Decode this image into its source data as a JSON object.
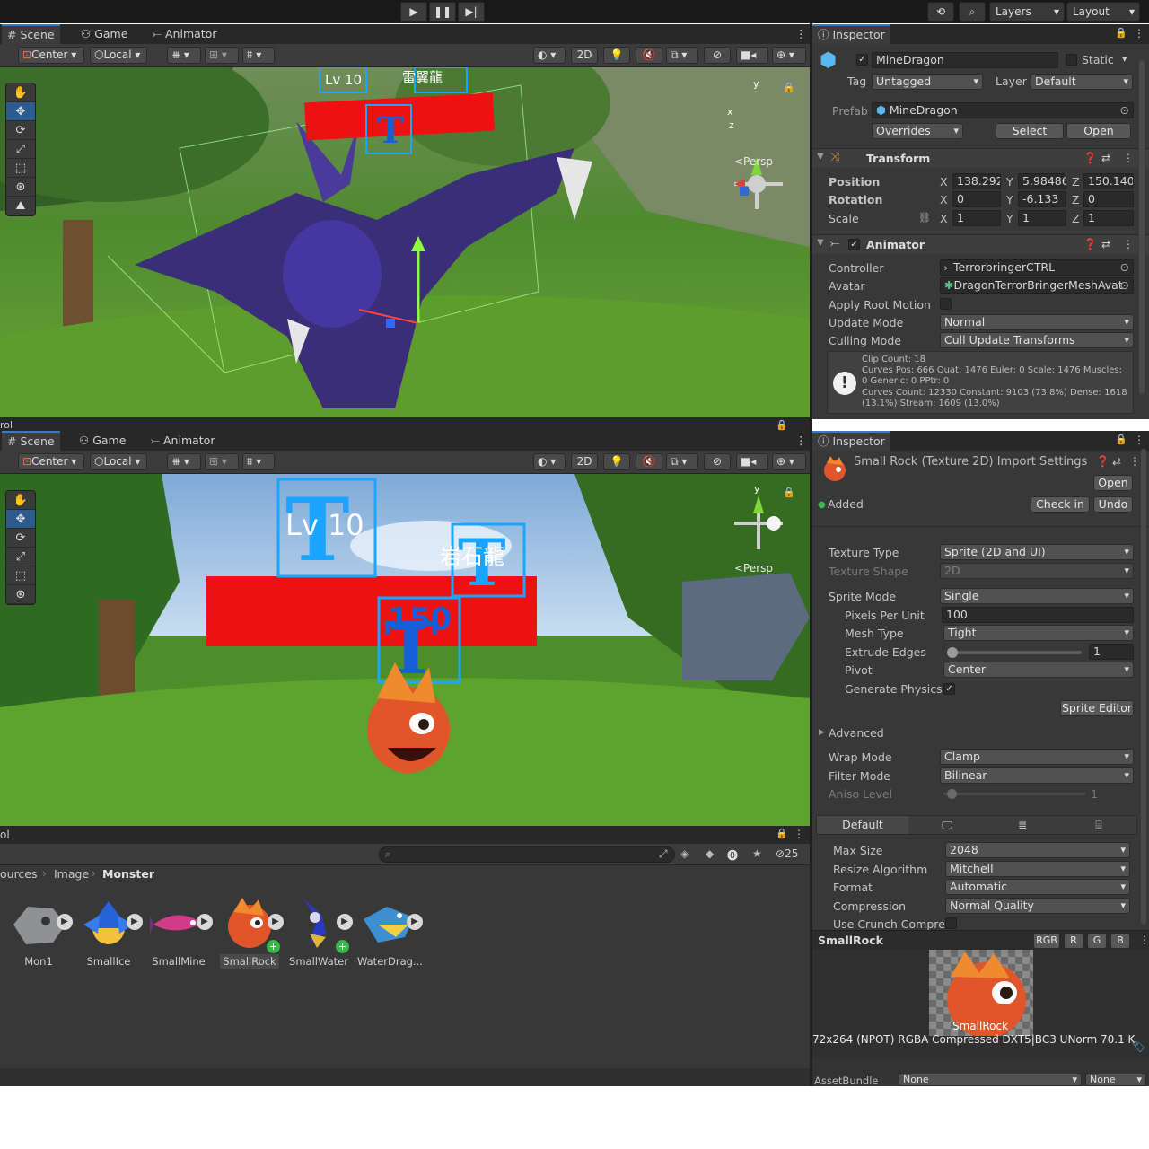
{
  "toolbar": {
    "play_icon": "play-icon",
    "pause_icon": "pause-icon",
    "step_icon": "step-icon",
    "layers": "Layers",
    "layout": "Layout"
  },
  "scene_top": {
    "tabs": [
      "Scene",
      "Game",
      "Animator"
    ],
    "pivot": "Center",
    "space": "Local",
    "mode_2d": "2D",
    "persp": "<Persp",
    "axis_y": "y",
    "axis_x": "x",
    "axis_z": "z",
    "label_lv": "Lv 10",
    "label_name": "雷翼龍"
  },
  "scene_bottom": {
    "tabs": [
      "Scene",
      "Game",
      "Animator"
    ],
    "pivot": "Center",
    "space": "Local",
    "mode_2d": "2D",
    "persp": "<Persp",
    "axis_y": "y",
    "label_lv": "Lv 10",
    "label_name": "岩石龍",
    "label_num": "150",
    "left_edge": "rol"
  },
  "inspector_top": {
    "tab": "Inspector",
    "object_name": "MineDragon",
    "static_label": "Static",
    "tag_label": "Tag",
    "tag_value": "Untagged",
    "layer_label": "Layer",
    "layer_value": "Default",
    "prefab_label": "Prefab",
    "prefab_value": "MineDragon",
    "overrides": "Overrides",
    "select": "Select",
    "open": "Open",
    "transform": {
      "title": "Transform",
      "position_label": "Position",
      "rotation_label": "Rotation",
      "scale_label": "Scale",
      "pos": {
        "x": "138.292",
        "y": "5.98486",
        "z": "150.140"
      },
      "rot": {
        "x": "0",
        "y": "-6.133",
        "z": "0"
      },
      "scl": {
        "x": "1",
        "y": "1",
        "z": "1"
      }
    },
    "animator": {
      "title": "Animator",
      "controller_label": "Controller",
      "controller_value": "TerrorbringerCTRL",
      "avatar_label": "Avatar",
      "avatar_value": "DragonTerrorBringerMeshAvat",
      "apply_root_label": "Apply Root Motion",
      "update_label": "Update Mode",
      "update_value": "Normal",
      "culling_label": "Culling Mode",
      "culling_value": "Cull Update Transforms",
      "info": [
        "Clip Count: 18",
        "Curves Pos: 666 Quat: 1476 Euler: 0 Scale: 1476 Muscles:",
        "0 Generic: 0 PPtr: 0",
        "Curves Count: 12330 Constant: 9103 (73.8%) Dense: 1618",
        "(13.1%) Stream: 1609 (13.0%)"
      ]
    }
  },
  "inspector_bottom": {
    "tab": "Inspector",
    "title": "Small Rock (Texture 2D) Import Settings",
    "open": "Open",
    "added": "Added",
    "check_in": "Check in",
    "undo": "Undo",
    "texture_type_label": "Texture Type",
    "texture_type": "Sprite (2D and UI)",
    "texture_shape_label": "Texture Shape",
    "texture_shape": "2D",
    "sprite_mode_label": "Sprite Mode",
    "sprite_mode": "Single",
    "ppu_label": "Pixels Per Unit",
    "ppu": "100",
    "mesh_type_label": "Mesh Type",
    "mesh_type": "Tight",
    "extrude_label": "Extrude Edges",
    "extrude": "1",
    "extrude_fraction": 0.0,
    "pivot_label": "Pivot",
    "pivot": "Center",
    "gen_physics_label": "Generate Physics",
    "sprite_editor": "Sprite Editor",
    "advanced": "Advanced",
    "wrap_label": "Wrap Mode",
    "wrap": "Clamp",
    "filter_label": "Filter Mode",
    "filter": "Bilinear",
    "aniso_label": "Aniso Level",
    "aniso": "1",
    "platform_default": "Default",
    "max_size_label": "Max Size",
    "max_size": "2048",
    "resize_label": "Resize Algorithm",
    "resize": "Mitchell",
    "format_label": "Format",
    "format": "Automatic",
    "compression_label": "Compression",
    "compression": "Normal Quality",
    "crunch_label": "Use Crunch Compres",
    "preview_name": "SmallRock",
    "channels": [
      "RGB",
      "R",
      "G",
      "B"
    ],
    "preview_caption": "SmallRock",
    "preview_info": "72x264 (NPOT)  RGBA Compressed DXT5|BC3 UNorm   70.1 K",
    "assetbundle_label": "AssetBundle",
    "assetbundle_value": "None",
    "assetbundle_variant": "None"
  },
  "project": {
    "left_edge": "ol",
    "breadcrumb": [
      "ources",
      "Image",
      "Monster"
    ],
    "visible_count": "25",
    "assets": [
      {
        "name": "Mon1",
        "icon": "dragon-skull-icon",
        "selected": false
      },
      {
        "name": "SmallIce",
        "icon": "ice-urchin-icon",
        "selected": false
      },
      {
        "name": "SmallMine",
        "icon": "fish-icon",
        "selected": false
      },
      {
        "name": "SmallRock",
        "icon": "rock-monster-icon",
        "selected": true
      },
      {
        "name": "SmallWater",
        "icon": "water-creature-icon",
        "selected": false
      },
      {
        "name": "WaterDrag...",
        "icon": "water-dragon-icon",
        "selected": false
      }
    ]
  },
  "colors": {
    "accent": "#3a79bb",
    "bg_dark": "#191919",
    "panel": "#383838",
    "hp_bar": "#ee1111",
    "rect_outline": "#1aa6ff",
    "added_green": "#3bb74c"
  }
}
